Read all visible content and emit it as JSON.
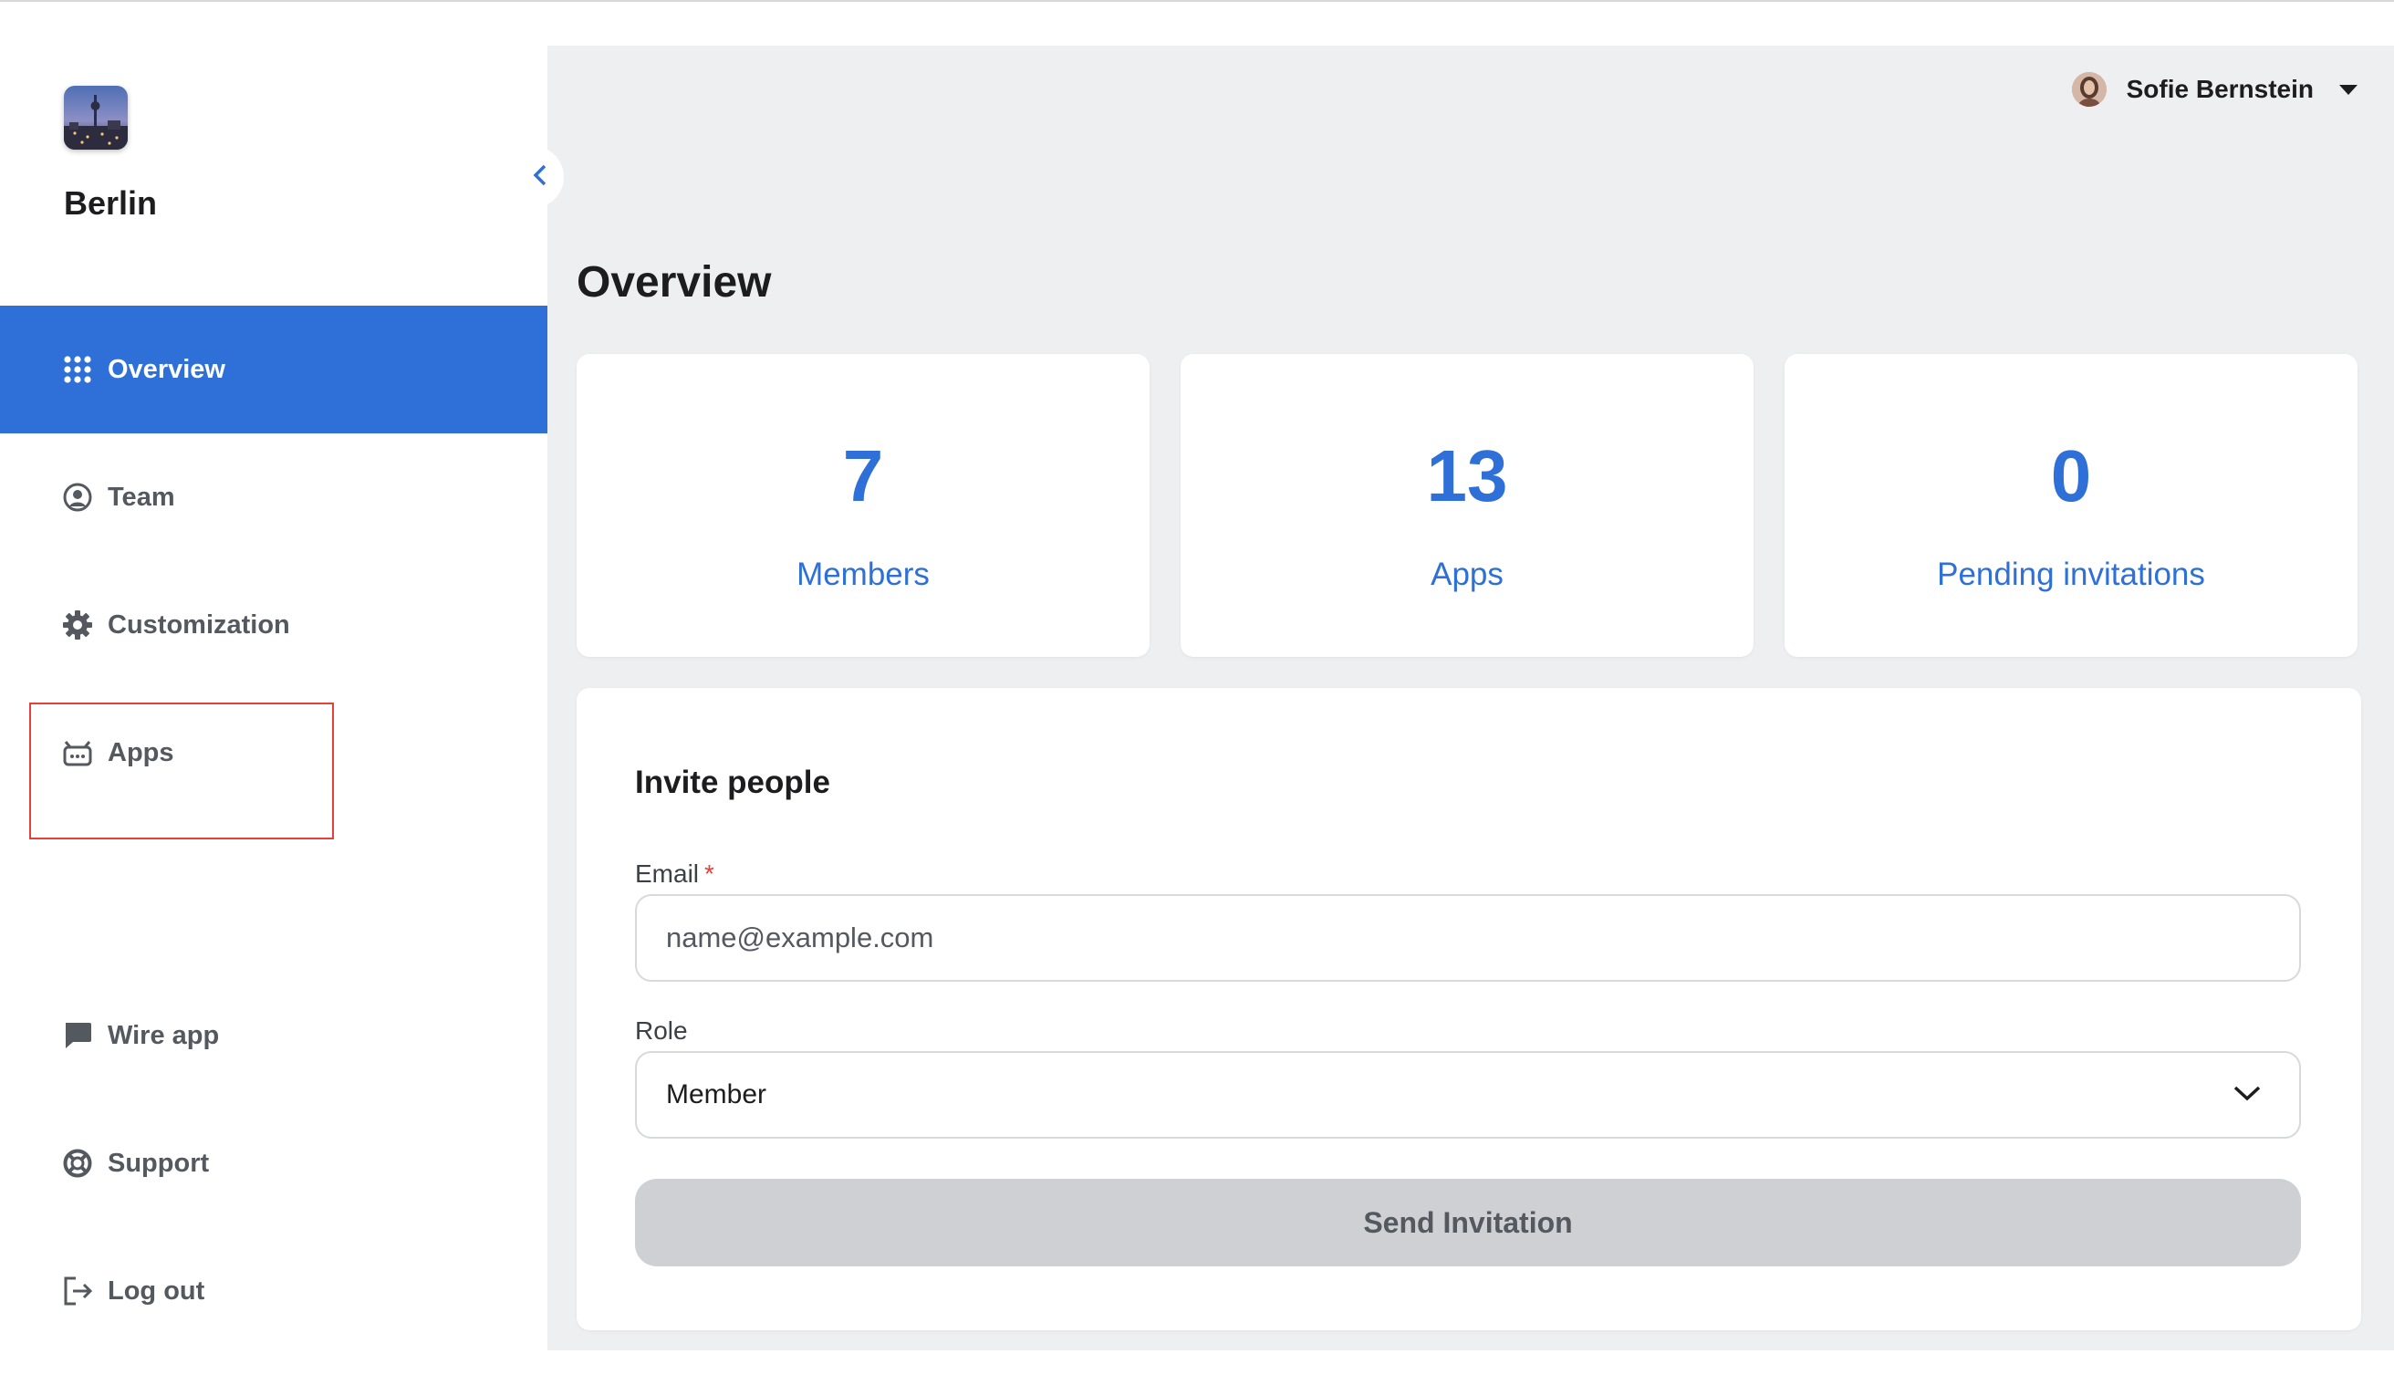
{
  "sidebar": {
    "team_name": "Berlin",
    "items": [
      {
        "label": "Overview",
        "icon": "grid-icon",
        "active": true
      },
      {
        "label": "Team",
        "icon": "user-circle-icon"
      },
      {
        "label": "Customization",
        "icon": "gear-icon"
      },
      {
        "label": "Apps",
        "icon": "bot-icon"
      },
      {
        "label": "Wire app",
        "icon": "chat-bubble-icon"
      },
      {
        "label": "Support",
        "icon": "lifebuoy-icon"
      },
      {
        "label": "Log out",
        "icon": "logout-icon"
      }
    ]
  },
  "header": {
    "user_name": "Sofie Bernstein"
  },
  "main": {
    "title": "Overview",
    "stats": [
      {
        "value": "7",
        "label": "Members"
      },
      {
        "value": "13",
        "label": "Apps"
      },
      {
        "value": "0",
        "label": "Pending invitations"
      }
    ],
    "invite": {
      "title": "Invite people",
      "email_label": "Email",
      "required_mark": "*",
      "email_placeholder": "name@example.com",
      "role_label": "Role",
      "role_value": "Member",
      "send_label": "Send Invitation"
    }
  },
  "colors": {
    "accent": "#2f6fd8",
    "highlight": "#e5413a",
    "main_bg": "#eeeff1",
    "button_disabled": "#cfd0d4"
  }
}
